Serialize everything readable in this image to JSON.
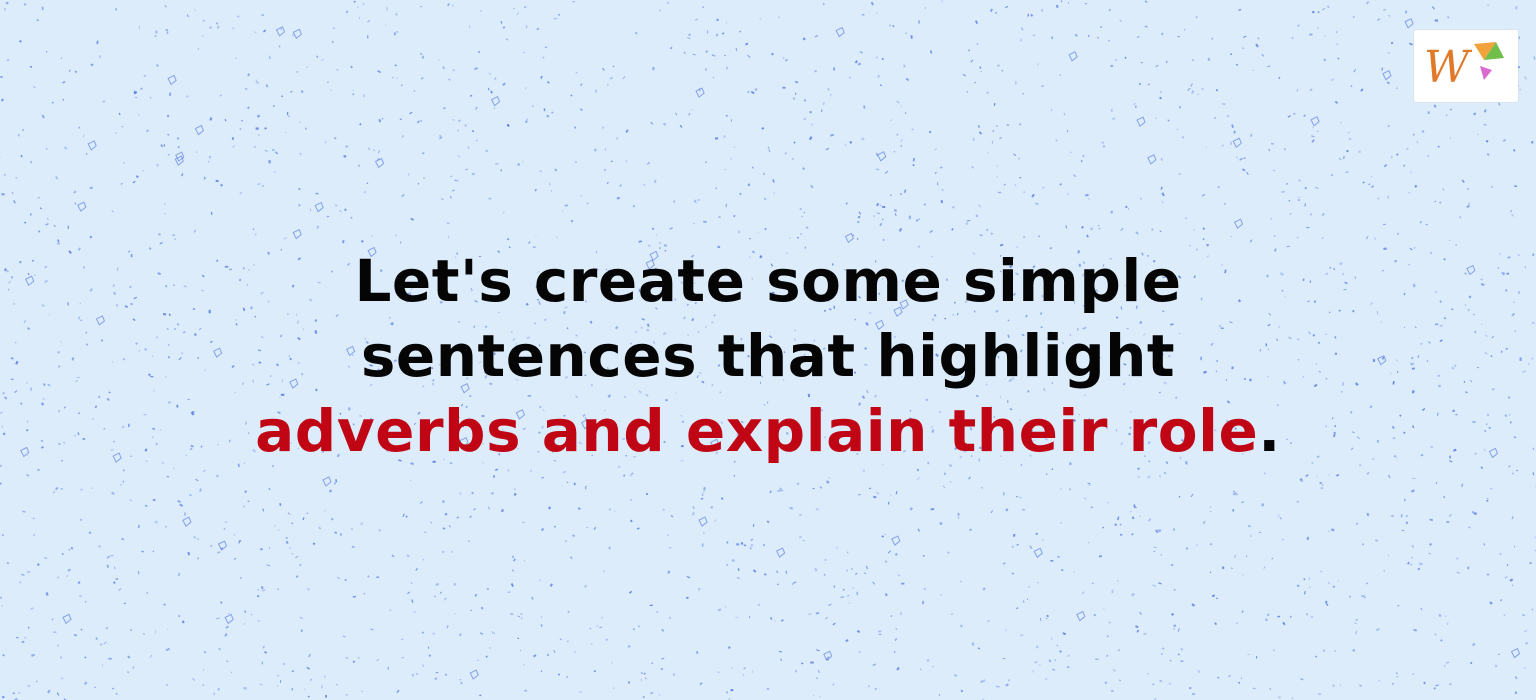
{
  "headline": {
    "line1": "Let's create some simple",
    "line2": "sentences that highlight",
    "line3_highlight": "adverbs and explain their role",
    "line3_end": "."
  },
  "logo": {
    "letter": "W",
    "icon": "brand-logo-icon"
  },
  "colors": {
    "background": "#dcecfb",
    "speckle": "#4a6fe0",
    "text": "#050505",
    "accent": "#c00614",
    "logo_letter": "#e07a2a"
  }
}
